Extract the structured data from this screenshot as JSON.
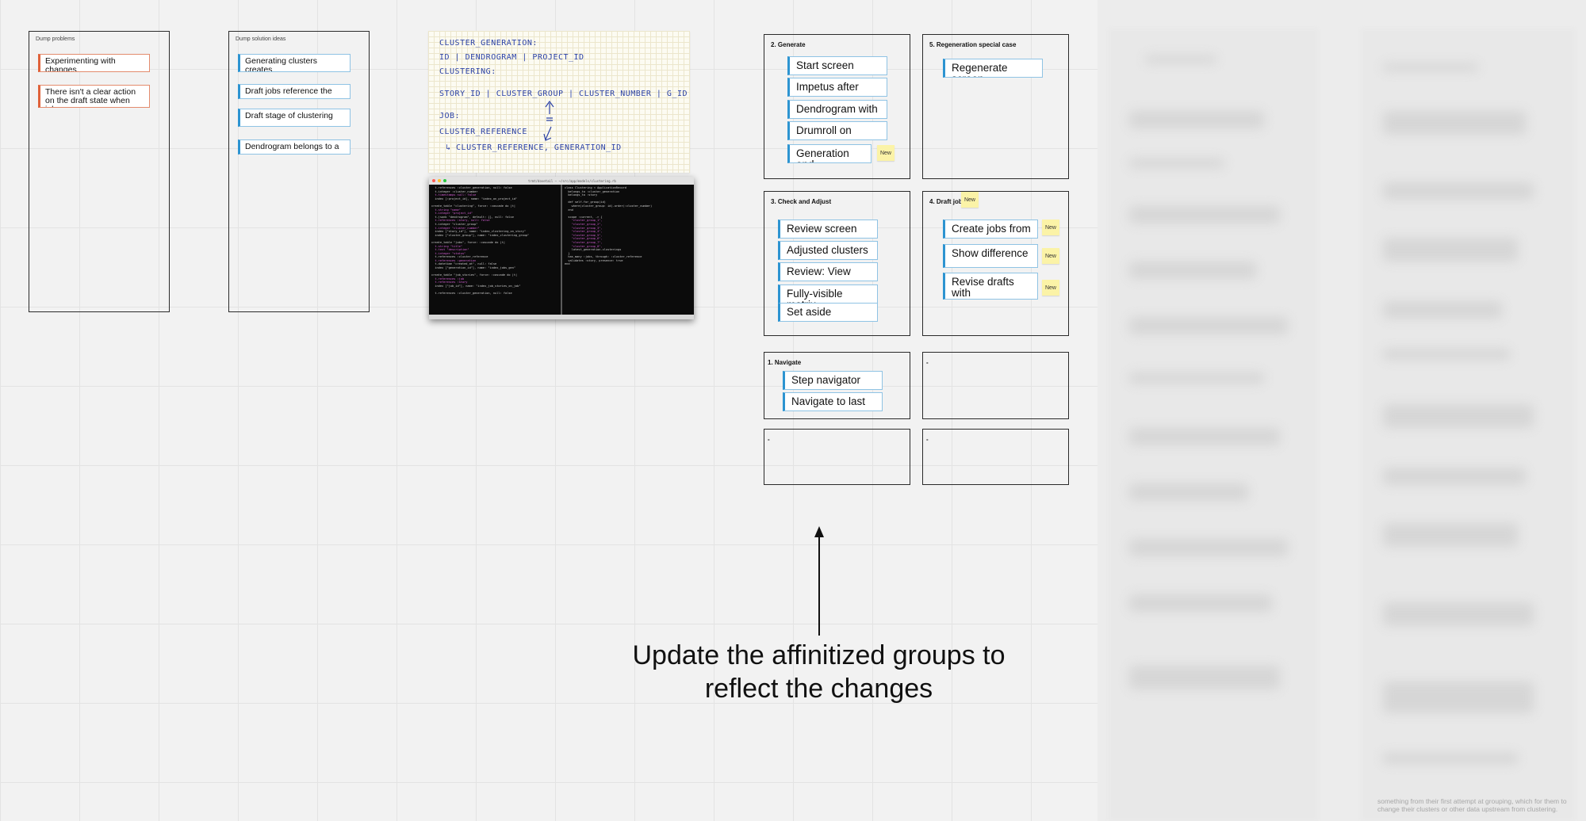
{
  "colors": {
    "canvas_bg": "#f2f2f2",
    "problem_accent": "#e0623a",
    "solution_accent": "#2d94d1",
    "sticky_yellow": "#fbf3a7",
    "frame_border": "#2a2a2a"
  },
  "dump_problems": {
    "title": "Dump problems",
    "cards": [
      "Experimenting with changes",
      "There isn't a clear action on the draft state when jobs"
    ]
  },
  "dump_solutions": {
    "title": "Dump solution ideas",
    "cards": [
      "Generating clusters creates",
      "Draft jobs reference the",
      "Draft stage of clustering",
      "Dendrogram belongs to a"
    ]
  },
  "sketch": {
    "lines": [
      "CLUSTER_GENERATION:",
      "ID | DENDROGRAM | PROJECT_ID",
      "CLUSTERING:",
      "STORY_ID | CLUSTER_GROUP | CLUSTER_NUMBER | G_ID",
      "JOB:",
      "CLUSTER_REFERENCE",
      "↳ CLUSTER_REFERENCE, GENERATION_ID"
    ]
  },
  "terminal": {
    "title": "trmt/dovetail — ~/src/app/models/clustering.rb"
  },
  "groups": {
    "generate": {
      "title": "2. Generate",
      "cards": [
        "Start screen",
        "Impetus after",
        "Dendrogram with",
        "Drumroll on",
        "Generation and"
      ],
      "sticky": "New"
    },
    "regeneration": {
      "title": "5. Regeneration special case",
      "cards": [
        "Regenerate screen"
      ]
    },
    "check_adjust": {
      "title": "3. Check and Adjust",
      "cards": [
        "Review screen",
        "Adjusted clusters",
        "Review: View",
        "Fully-visible matrix",
        "Set aside"
      ]
    },
    "draft_jobs": {
      "title": "4. Draft jobs",
      "title_sticky": "New",
      "cards": [
        "Create jobs from",
        "Show difference",
        "Revise drafts with"
      ],
      "stickies": [
        "New",
        "New",
        "New"
      ]
    },
    "navigate": {
      "title": "1. Navigate",
      "cards": [
        "Step navigator",
        "Navigate to last"
      ]
    },
    "empty_a": {
      "title": "-"
    },
    "empty_b": {
      "title": "-"
    },
    "empty_c": {
      "title": "-"
    }
  },
  "callout": {
    "line1": "Update the affinitized groups to",
    "line2": "reflect the changes"
  },
  "blurred_note": "something from their first attempt at grouping, which for them to change their clusters or other data upstream from clustering."
}
